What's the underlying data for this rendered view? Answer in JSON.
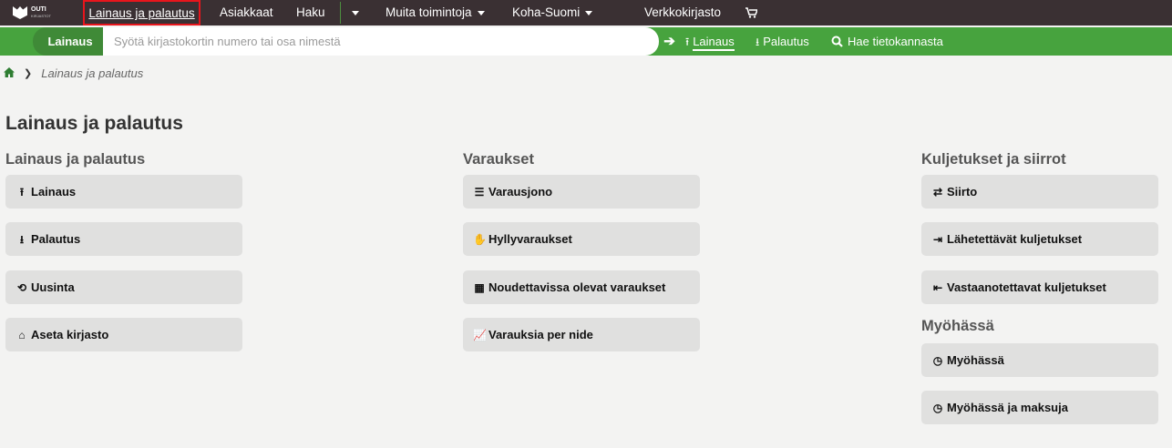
{
  "topnav": {
    "logo_text": "OUTI",
    "logo_subtext": "KIRJASTOT",
    "items": {
      "circulation": "Lainaus ja palautus",
      "patrons": "Asiakkaat",
      "search": "Haku",
      "more": "Muita toimintoja",
      "koha": "Koha-Suomi",
      "opac": "Verkkokirjasto"
    }
  },
  "searchbar": {
    "label": "Lainaus",
    "placeholder": "Syötä kirjastokortin numero tai osa nimestä",
    "links": {
      "checkout": "Lainaus",
      "checkin": "Palautus",
      "catalog": "Hae tietokannasta"
    }
  },
  "breadcrumb": {
    "current": "Lainaus ja palautus"
  },
  "page_title": "Lainaus ja palautus",
  "columns": {
    "circulation": {
      "heading": "Lainaus ja palautus",
      "buttons": [
        "Lainaus",
        "Palautus",
        "Uusinta",
        "Aseta kirjasto"
      ]
    },
    "holds": {
      "heading": "Varaukset",
      "buttons": [
        "Varausjono",
        "Hyllyvaraukset",
        "Noudettavissa olevat varaukset",
        "Varauksia per nide"
      ]
    },
    "transfers": {
      "heading": "Kuljetukset ja siirrot",
      "buttons": [
        "Siirto",
        "Lähetettävät kuljetukset",
        "Vastaanotettavat kuljetukset"
      ]
    },
    "overdues": {
      "heading": "Myöhässä",
      "buttons": [
        "Myöhässä",
        "Myöhässä ja maksuja"
      ]
    }
  },
  "colors": {
    "topnav_bg": "#3a3033",
    "accent_green": "#47a33e",
    "highlight_red": "#e8151c"
  }
}
